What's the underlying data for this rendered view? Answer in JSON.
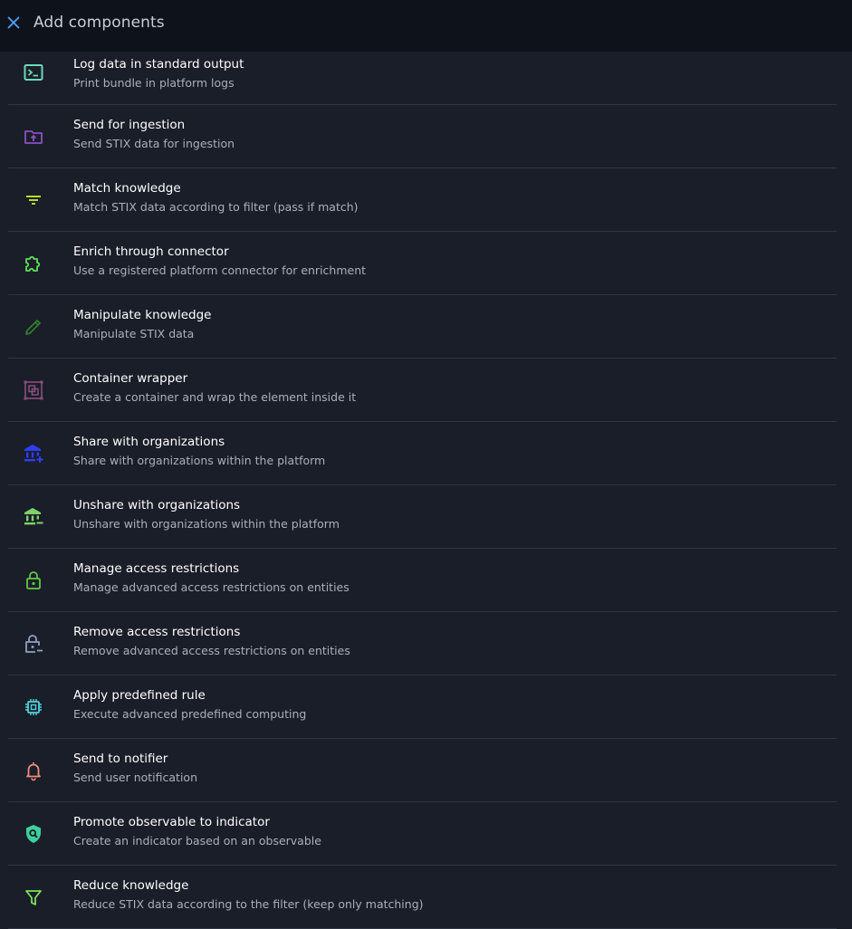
{
  "header": {
    "title": "Add components",
    "close_icon": "close-icon",
    "accent": "#4da3ff"
  },
  "components": [
    {
      "title": "Log data in standard output",
      "description": "Print bundle in platform logs",
      "icon": "console-icon",
      "color": "#6dd9b8"
    },
    {
      "title": "Send for ingestion",
      "description": "Send STIX data for ingestion",
      "icon": "folder-upload-icon",
      "color": "#8c4fc4"
    },
    {
      "title": "Match knowledge",
      "description": "Match STIX data according to filter (pass if match)",
      "icon": "filter-list-icon",
      "color": "#b7d92b"
    },
    {
      "title": "Enrich through connector",
      "description": "Use a registered platform connector for enrichment",
      "icon": "puzzle-icon",
      "color": "#5fde5a"
    },
    {
      "title": "Manipulate knowledge",
      "description": "Manipulate STIX data",
      "icon": "pencil-icon",
      "color": "#2e7d32"
    },
    {
      "title": "Container wrapper",
      "description": "Create a container and wrap the element inside it",
      "icon": "select-group-icon",
      "color": "#8a4e7f"
    },
    {
      "title": "Share with organizations",
      "description": "Share with organizations within the platform",
      "icon": "bank-plus-icon",
      "color": "#2f3df0"
    },
    {
      "title": "Unshare with organizations",
      "description": "Unshare with organizations within the platform",
      "icon": "bank-minus-icon",
      "color": "#7fd26a"
    },
    {
      "title": "Manage access restrictions",
      "description": "Manage advanced access restrictions on entities",
      "icon": "lock-icon",
      "color": "#5fc944"
    },
    {
      "title": "Remove access restrictions",
      "description": "Remove advanced access restrictions on entities",
      "icon": "lock-minus-icon",
      "color": "#8ea0c4"
    },
    {
      "title": "Apply predefined rule",
      "description": "Execute advanced predefined computing",
      "icon": "chip-icon",
      "color": "#4fd1d9"
    },
    {
      "title": "Send to notifier",
      "description": "Send user notification",
      "icon": "bell-icon",
      "color": "#ef8a7a"
    },
    {
      "title": "Promote observable to indicator",
      "description": "Create an indicator based on an observable",
      "icon": "shield-search-icon",
      "color": "#3ecf9e"
    },
    {
      "title": "Reduce knowledge",
      "description": "Reduce STIX data according to the filter (keep only matching)",
      "icon": "funnel-icon",
      "color": "#7be35a"
    }
  ]
}
